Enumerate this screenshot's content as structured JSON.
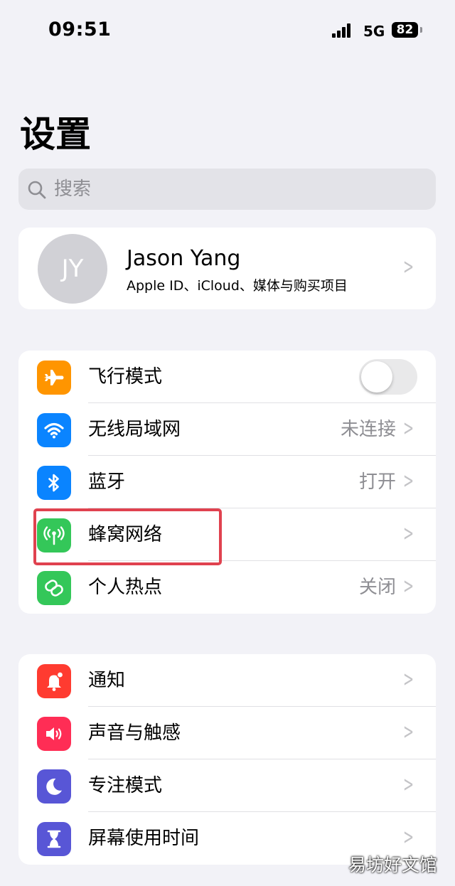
{
  "status_bar": {
    "time": "09:51",
    "network": "5G",
    "battery": "82"
  },
  "page": {
    "title": "设置"
  },
  "search": {
    "placeholder": "搜索"
  },
  "profile": {
    "initials": "JY",
    "name": "Jason Yang",
    "subtitle": "Apple ID、iCloud、媒体与购买项目"
  },
  "connectivity": [
    {
      "label": "飞行模式",
      "icon": "airplane-icon",
      "color": "#ff9500",
      "toggle": false
    },
    {
      "label": "无线局域网",
      "icon": "wifi-icon",
      "color": "#0a84ff",
      "value": "未连接"
    },
    {
      "label": "蓝牙",
      "icon": "bluetooth-icon",
      "color": "#0a84ff",
      "value": "打开"
    },
    {
      "label": "蜂窝网络",
      "icon": "antenna-icon",
      "color": "#34c759",
      "value": ""
    },
    {
      "label": "个人热点",
      "icon": "hotspot-icon",
      "color": "#34c759",
      "value": "关闭"
    }
  ],
  "notifications": [
    {
      "label": "通知",
      "icon": "bell-icon",
      "color": "#ff3b30"
    },
    {
      "label": "声音与触感",
      "icon": "speaker-icon",
      "color": "#ff2d55"
    },
    {
      "label": "专注模式",
      "icon": "moon-icon",
      "color": "#5856d6"
    },
    {
      "label": "屏幕使用时间",
      "icon": "hourglass-icon",
      "color": "#5856d6"
    }
  ],
  "watermark": "易坊好文馆"
}
